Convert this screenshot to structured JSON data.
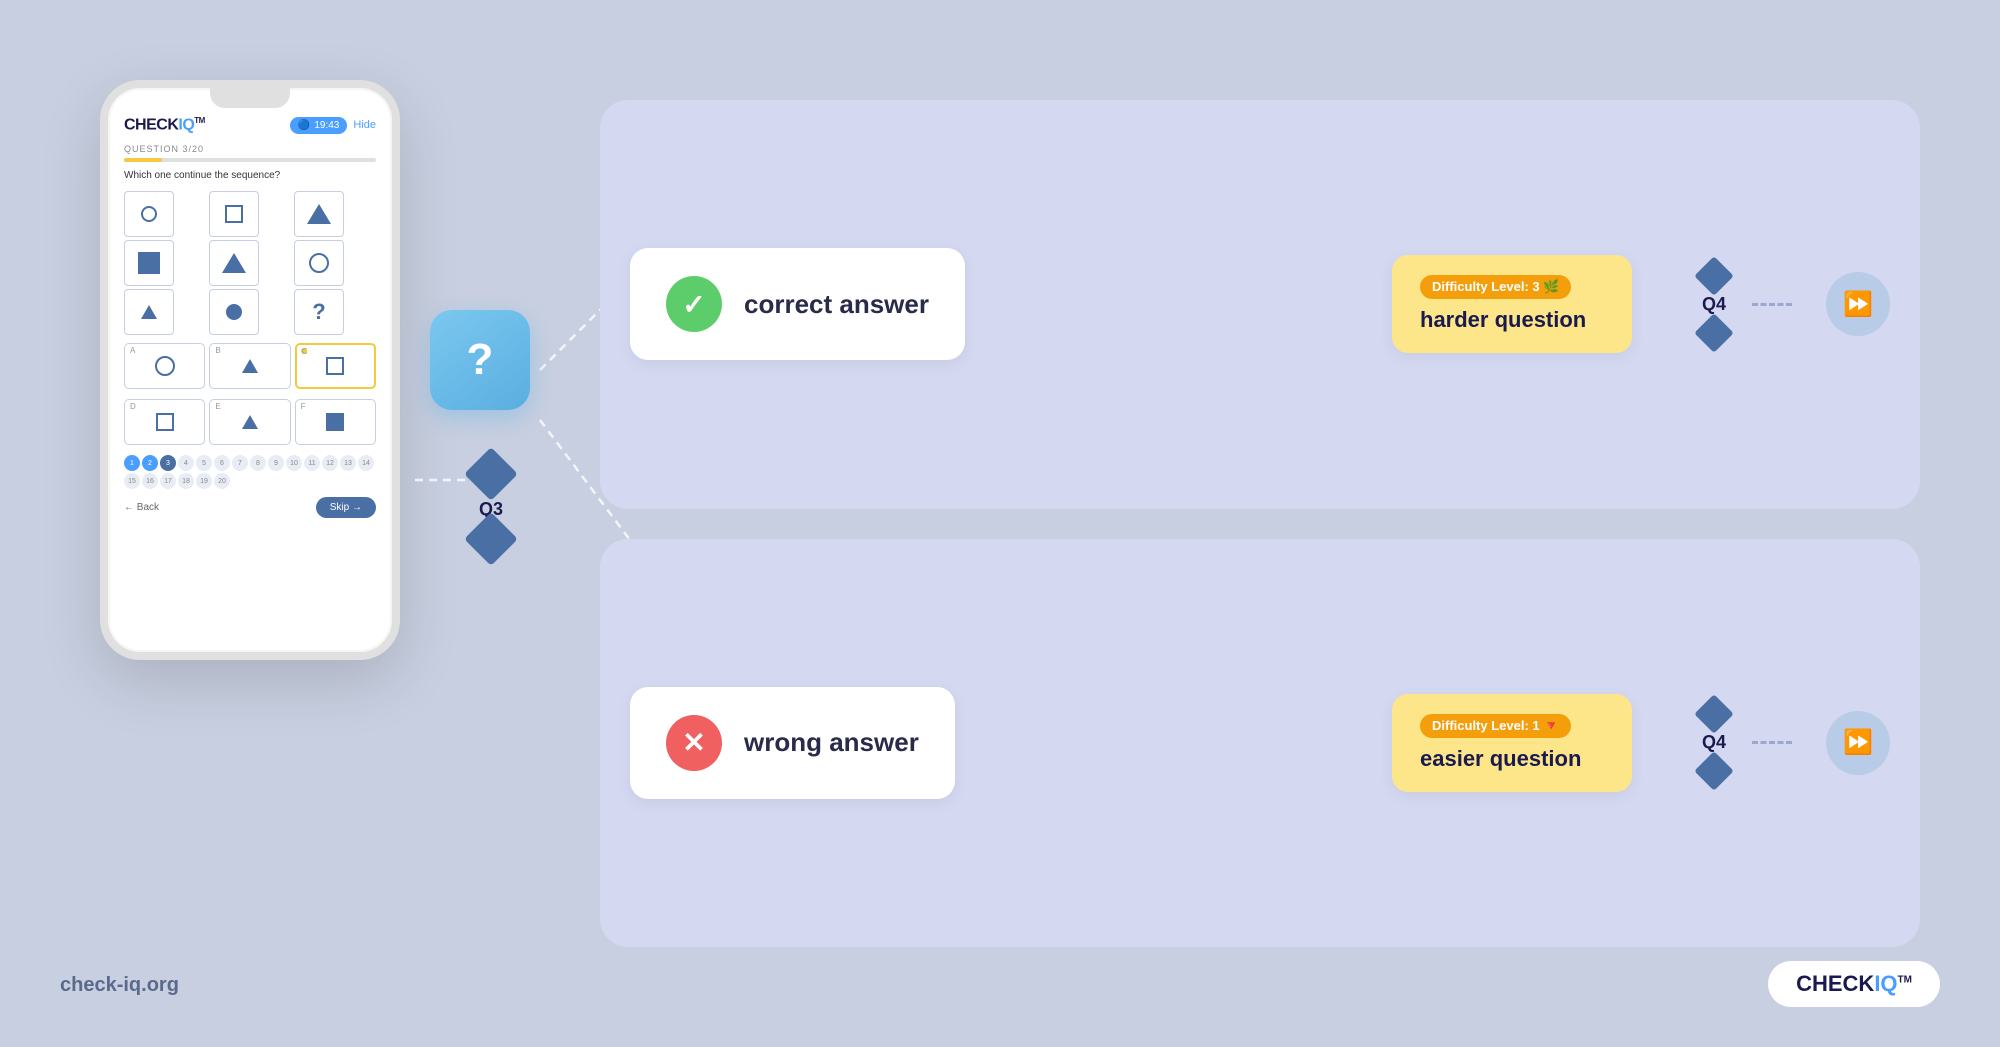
{
  "app": {
    "name": "CHECKIQ",
    "tm": "TM",
    "website": "check-iq.org"
  },
  "phone": {
    "timer": "19:43",
    "hide_label": "Hide",
    "question_label": "QUESTION 3/20",
    "question_text": "Which one continue the sequence?",
    "back_label": "← Back",
    "skip_label": "Skip →",
    "progress_percent": 15
  },
  "q3": {
    "label": "Q3",
    "symbol": "?"
  },
  "correct_branch": {
    "answer_label": "correct answer",
    "difficulty_badge": "Difficulty Level: 3 🌿",
    "difficulty_desc": "harder question",
    "q4_label": "Q4"
  },
  "wrong_branch": {
    "answer_label": "wrong answer",
    "difficulty_badge": "Difficulty Level: 1 🔻",
    "difficulty_desc": "easier question",
    "q4_label": "Q4"
  },
  "icons": {
    "correct_icon": "✓",
    "wrong_icon": "✕",
    "play_icon": "⏩",
    "question_icon": "?"
  }
}
